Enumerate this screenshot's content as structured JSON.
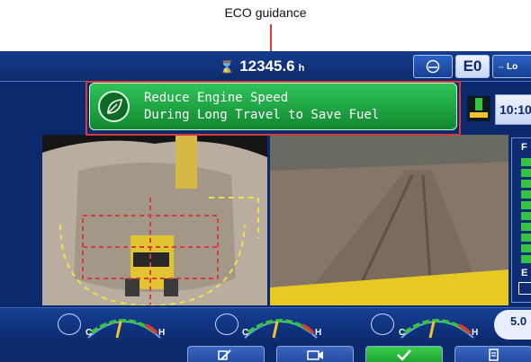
{
  "annotation": {
    "label": "ECO guidance"
  },
  "topbar": {
    "hourmeter_value": "12345.6",
    "hourmeter_unit": "h",
    "mode_label": "E0",
    "lo_label": "Lo"
  },
  "guidance": {
    "line1": "Reduce Engine Speed",
    "line2": "During Long Travel to Save Fuel"
  },
  "clock": {
    "time": "10:10"
  },
  "fuel": {
    "label_full": "F",
    "label_empty": "E",
    "level": 1.0
  },
  "gauges": [
    {
      "name": "coolant",
      "low": "C",
      "high": "H"
    },
    {
      "name": "hydraulic",
      "low": "C",
      "high": "H"
    },
    {
      "name": "oil",
      "low": "C",
      "high": "H"
    }
  ],
  "side_value": {
    "value": "5.0"
  },
  "colors": {
    "eco": "#12882f",
    "screen": "#0b2a6e",
    "highlight": "#d43b3b",
    "needle": "#f2c230"
  }
}
